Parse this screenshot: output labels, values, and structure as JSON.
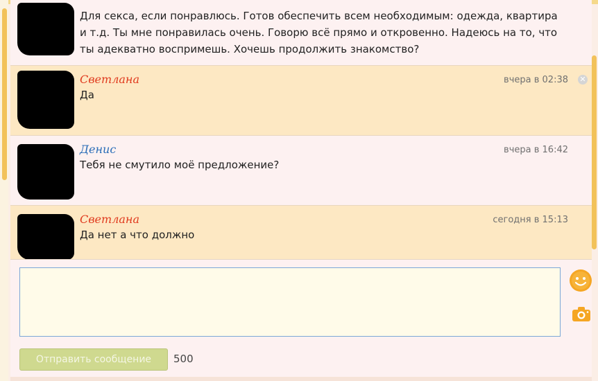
{
  "messages": [
    {
      "author": "",
      "time": "",
      "text": "Для секса, если понравлюсь. Готов обеспечить всем необходимым: одежда, квартира и т.д. Ты мне понравилась очень. Говорю всё прямо и откровенно. Надеюсь на то, что ты адекватно воспримешь. Хочешь продолжить знакомство?"
    },
    {
      "author": "Светлана",
      "time": "вчера в 02:38",
      "text": "Да"
    },
    {
      "author": "Денис",
      "time": "вчера в 16:42",
      "text": "Тебя не смутило моё предложение?"
    },
    {
      "author": "Светлана",
      "time": "сегодня в 15:13",
      "text": "Да нет а что должно"
    }
  ],
  "compose": {
    "input_value": "",
    "send_label": "Отправить сообщение",
    "char_count": "500"
  },
  "icons": {
    "smile": "smile-icon",
    "camera": "camera-icon",
    "delete": "close-circle-icon"
  },
  "colors": {
    "incoming_bg": "#fde8c3",
    "outgoing_bg": "#fdf1f1",
    "author_red": "#e03a1e",
    "author_blue": "#2a6db8",
    "send_button": "#cfd98f",
    "accent_orange": "#f5a623"
  }
}
